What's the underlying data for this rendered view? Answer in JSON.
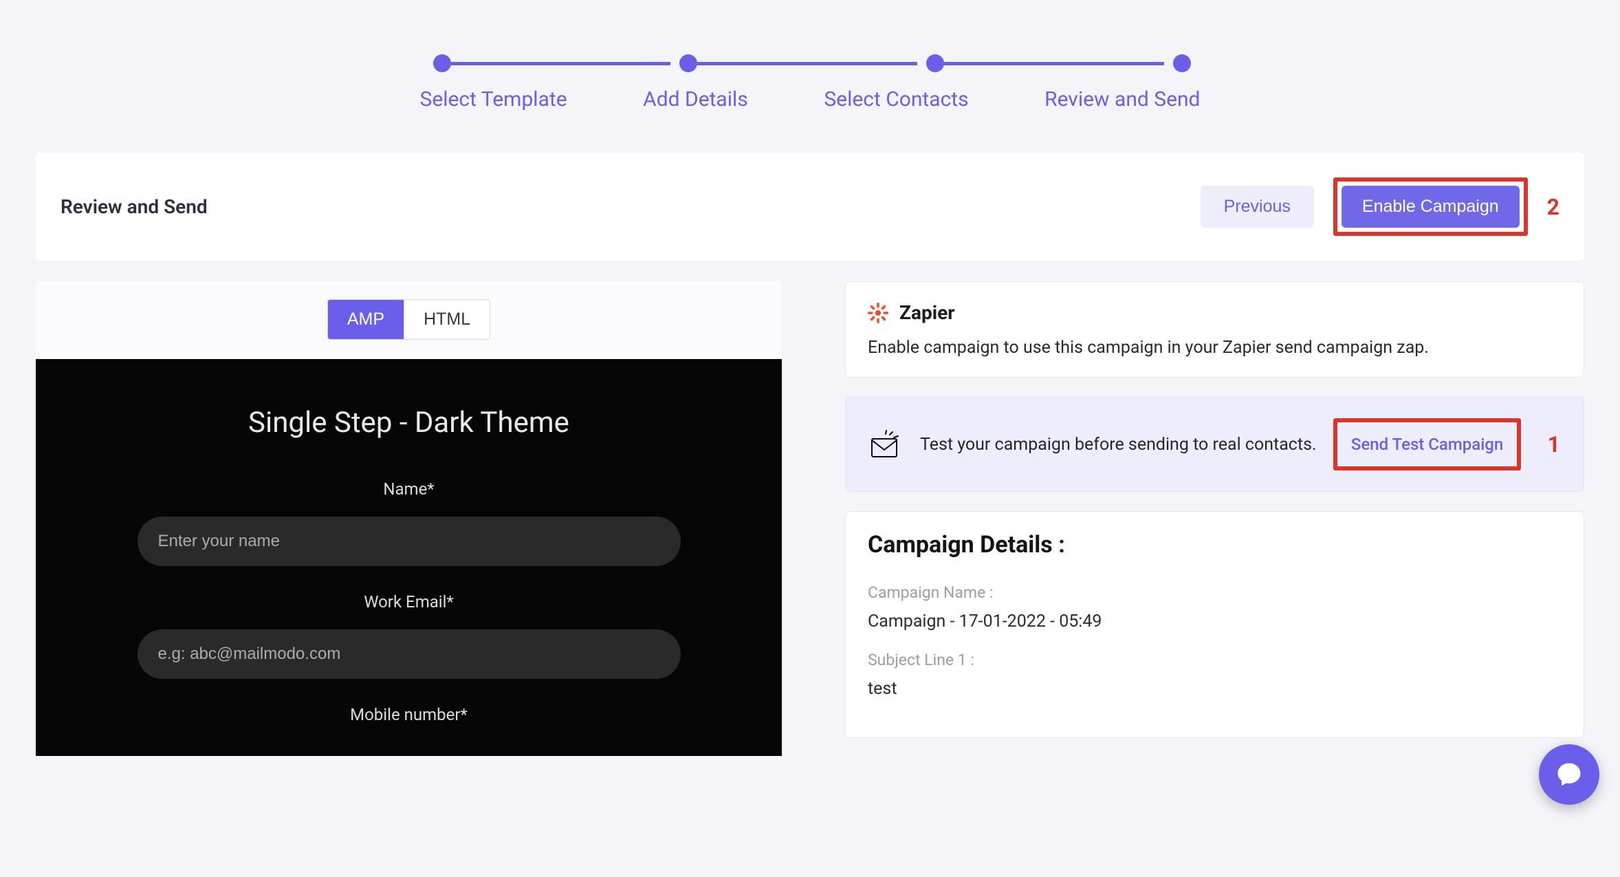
{
  "stepper": {
    "steps": [
      "Select Template",
      "Add Details",
      "Select Contacts",
      "Review and Send"
    ]
  },
  "header": {
    "title": "Review and Send",
    "previous": "Previous",
    "enable": "Enable Campaign"
  },
  "annotations": {
    "one": "1",
    "two": "2"
  },
  "preview": {
    "tab_amp": "AMP",
    "tab_html": "HTML",
    "form_title": "Single Step - Dark Theme",
    "name_label": "Name*",
    "name_placeholder": "Enter your name",
    "email_label": "Work Email*",
    "email_placeholder": "e.g: abc@mailmodo.com",
    "mobile_label": "Mobile number*"
  },
  "zapier": {
    "title": "Zapier",
    "body": "Enable campaign to use this campaign in your Zapier send campaign zap."
  },
  "test": {
    "text": "Test your campaign before sending to real contacts.",
    "link": "Send Test Campaign"
  },
  "details": {
    "heading": "Campaign Details :",
    "name_label": "Campaign Name :",
    "name_value": "Campaign - 17-01-2022 - 05:49",
    "subject_label": "Subject Line 1 :",
    "subject_value": "test"
  }
}
